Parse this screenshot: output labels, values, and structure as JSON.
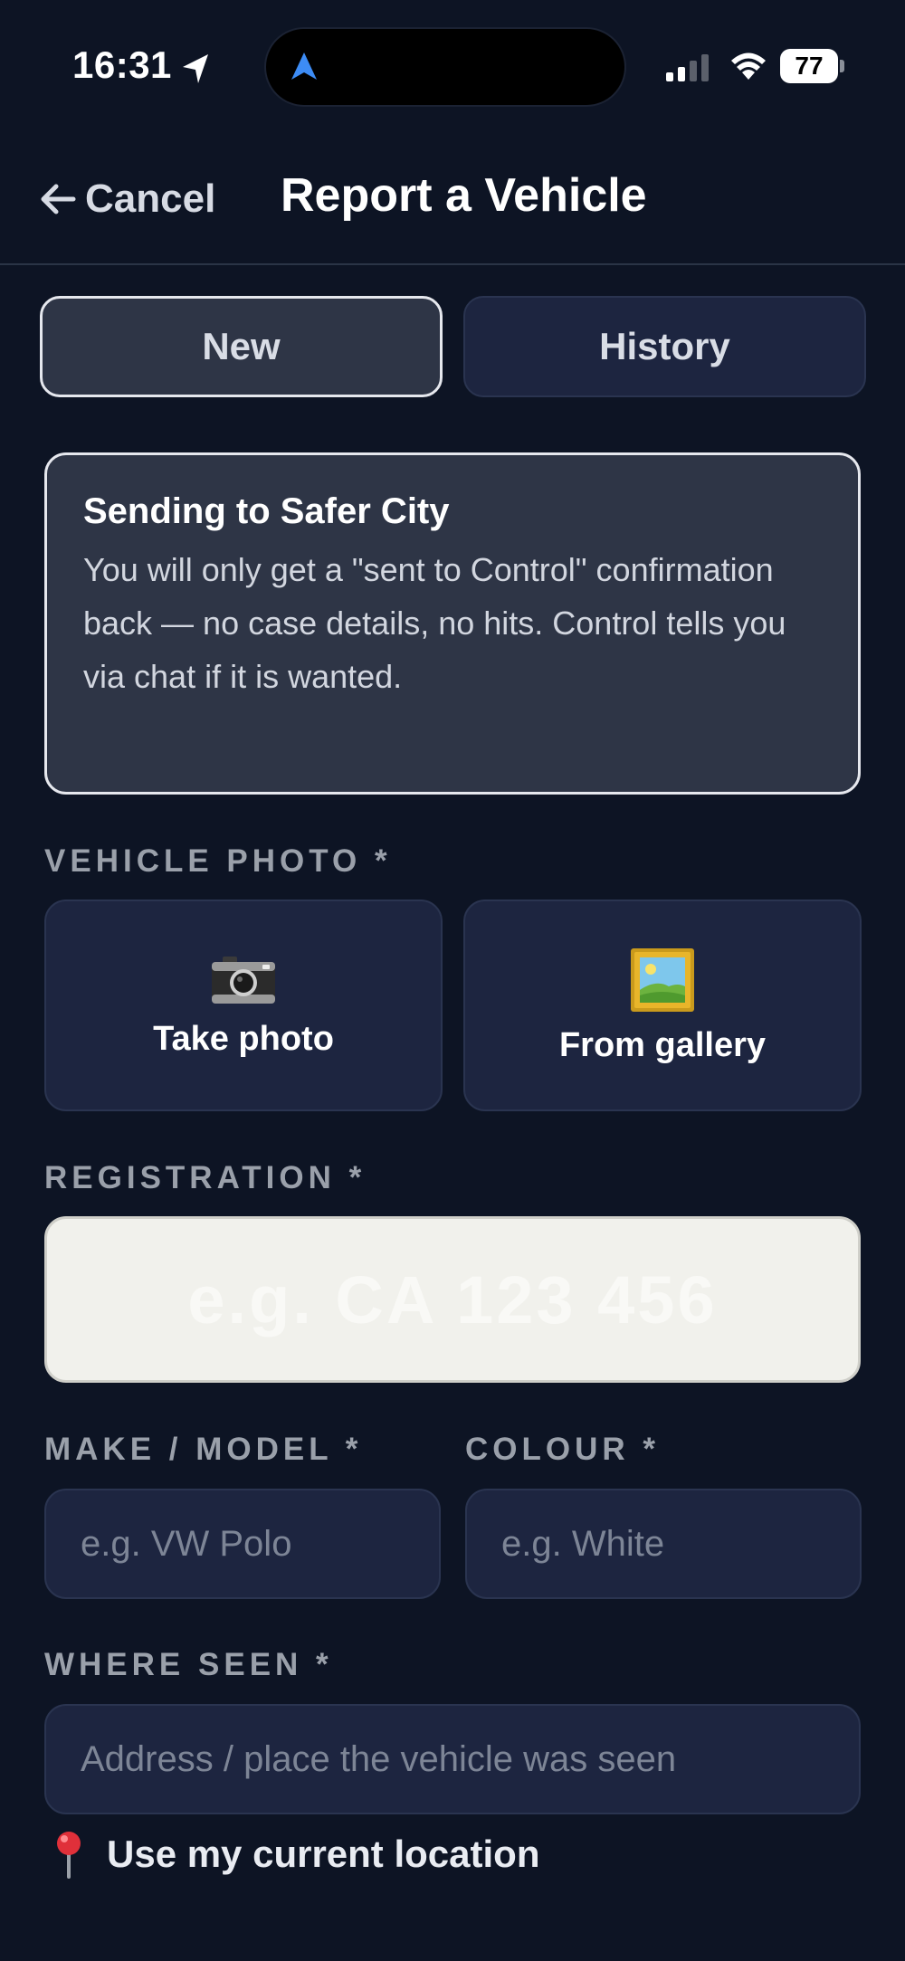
{
  "status_bar": {
    "time": "16:31",
    "battery": "77"
  },
  "header": {
    "back_label": "Cancel",
    "title": "Report a Vehicle"
  },
  "tabs": [
    {
      "label": "New",
      "active": true
    },
    {
      "label": "History",
      "active": false
    }
  ],
  "info_card": {
    "title": "Sending to Safer City",
    "body": "You will only get a \"sent to Control\" confirmation back — no case details, no hits. Control tells you via chat if it is wanted."
  },
  "photo": {
    "label": "VEHICLE PHOTO *",
    "take_photo": "Take photo",
    "from_gallery": "From gallery",
    "take_icon": "camera-icon",
    "gallery_icon": "framed-picture-icon"
  },
  "registration": {
    "label": "REGISTRATION *",
    "placeholder": "e.g. CA 123 456",
    "value": ""
  },
  "make_model": {
    "label": "MAKE / MODEL *",
    "placeholder": "e.g. VW Polo"
  },
  "colour": {
    "label": "COLOUR *",
    "placeholder": "e.g. White"
  },
  "where_seen": {
    "label": "WHERE SEEN *",
    "placeholder": "Address / place the vehicle was seen",
    "use_location": "Use my current location",
    "location_icon": "round-pushpin-icon"
  },
  "colors": {
    "background": "#0d1424",
    "card": "#1d2540",
    "active_card": "#2e3546",
    "label_gray": "#9aa0aa",
    "registration_plate": "#f1f1ec"
  }
}
